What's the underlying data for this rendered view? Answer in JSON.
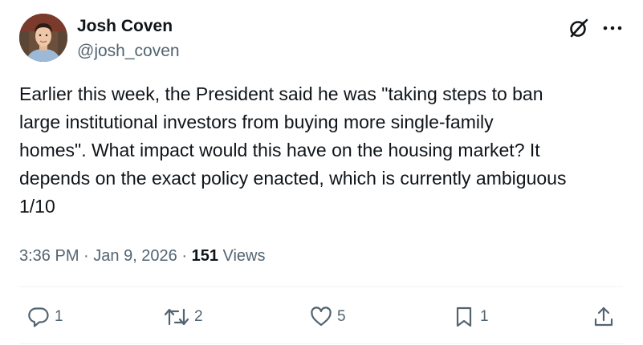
{
  "author": {
    "name": "Josh Coven",
    "handle": "@josh_coven",
    "avatar_icon": "user-photo"
  },
  "header_icons": {
    "grok": "grok-icon",
    "more": "more-icon"
  },
  "tweet": {
    "text": "Earlier this week, the President said he was \"taking steps to ban\nlarge institutional investors from buying more single-family\nhomes\". What impact would this have on the housing market? It\ndepends on the exact policy enacted, which is currently ambiguous\n1/10"
  },
  "meta": {
    "time": "3:36 PM",
    "sep1": " · ",
    "date": "Jan 9, 2026",
    "sep2": " · ",
    "views_count": "151",
    "views_label": " Views"
  },
  "actions": {
    "reply_count": "1",
    "retweet_count": "2",
    "like_count": "5",
    "bookmark_count": "1"
  },
  "colors": {
    "text": "#0f1419",
    "secondary": "#536471",
    "divider": "#eff3f4"
  }
}
